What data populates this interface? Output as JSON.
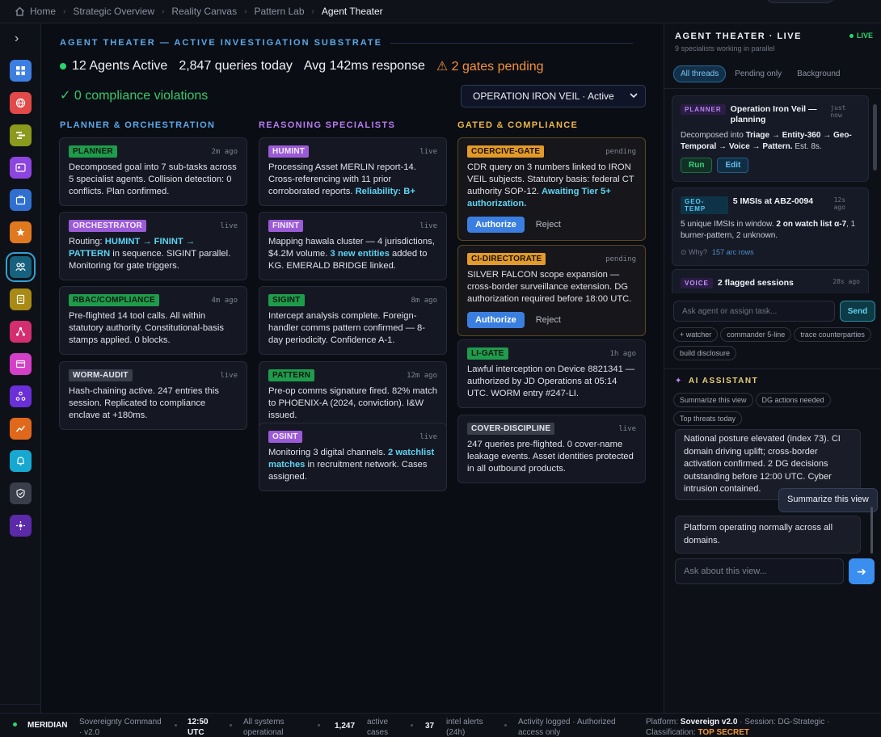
{
  "breadcrumb": {
    "items": [
      "Home",
      "Strategic Overview",
      "Reality Canvas",
      "Pattern Lab",
      "Agent Theater"
    ]
  },
  "main": {
    "section_title": "AGENT THEATER — ACTIVE INVESTIGATION SUBSTRATE",
    "stats": {
      "agents": "12 Agents Active",
      "queries": "2,847 queries today",
      "response": "Avg 142ms response",
      "gates": "⚠ 2 gates pending"
    },
    "compliance": "✓ 0 compliance violations",
    "operation_select": "OPERATION IRON VEIL · Active",
    "columns": {
      "planner": "PLANNER & ORCHESTRATION",
      "reasoning": "REASONING SPECIALISTS",
      "gated": "GATED & COMPLIANCE"
    },
    "cards": {
      "planner": {
        "tag": "PLANNER",
        "time": "2m ago",
        "text": "Decomposed goal into 7 sub-tasks across 5 specialist agents. Collision detection: 0 conflicts. Plan confirmed."
      },
      "orchestrator": {
        "tag": "ORCHESTRATOR",
        "time": "live",
        "pre": "Routing: ",
        "hl": "HUMINT → FININT → PATTERN",
        "post": " in sequence. SIGINT parallel. Monitoring for gate triggers."
      },
      "rbac": {
        "tag": "RBAC/COMPLIANCE",
        "time": "4m ago",
        "text": "Pre-flighted 14 tool calls. All within statutory authority. Constitutional-basis stamps applied. 0 blocks."
      },
      "worm": {
        "tag": "WORM-AUDIT",
        "time": "live",
        "text": "Hash-chaining active. 247 entries this session. Replicated to compliance enclave at +180ms."
      },
      "humint": {
        "tag": "HUMINT",
        "time": "live",
        "pre": "Processing Asset MERLIN report-14. Cross-referencing with 11 prior corroborated reports. ",
        "hl": "Reliability: B+"
      },
      "finint": {
        "tag": "FININT",
        "time": "live",
        "pre": "Mapping hawala cluster — 4 jurisdictions, $4.2M volume. ",
        "hl": "3 new entities",
        "post": " added to KG. EMERALD BRIDGE linked."
      },
      "sigint": {
        "tag": "SIGINT",
        "time": "8m ago",
        "text": "Intercept analysis complete. Foreign-handler comms pattern confirmed — 8-day periodicity. Confidence A-1."
      },
      "pattern": {
        "tag": "PATTERN",
        "time": "12m ago",
        "text": "Pre-op comms signature fired. 82% match to PHOENIX-A (2024, conviction). I&W issued."
      },
      "osint": {
        "tag": "OSINT",
        "time": "live",
        "pre": "Monitoring 3 digital channels. ",
        "hl": "2 watchlist matches",
        "post": " in recruitment network. Cases assigned."
      },
      "coercive": {
        "tag": "COERCIVE-GATE",
        "time": "pending",
        "pre": "CDR query on 3 numbers linked to IRON VEIL subjects. Statutory basis: federal CT authority SOP-12. ",
        "hl": "Awaiting Tier 5+ authorization.",
        "authorize": "Authorize",
        "reject": "Reject"
      },
      "ci": {
        "tag": "CI-DIRECTORATE",
        "time": "pending",
        "text": "SILVER FALCON scope expansion — cross-border surveillance extension. DG authorization required before 18:00 UTC.",
        "authorize": "Authorize",
        "reject": "Reject"
      },
      "li": {
        "tag": "LI-GATE",
        "time": "1h ago",
        "text": "Lawful interception on Device 8821341 — authorized by JD Operations at 05:14 UTC. WORM entry #247-LI."
      },
      "cover": {
        "tag": "COVER-DISCIPLINE",
        "time": "live",
        "text": "247 queries pre-flighted. 0 cover-name leakage events. Asset identities protected in all outbound products."
      }
    }
  },
  "panel": {
    "title": "AGENT THEATER · LIVE",
    "subtitle": "9 specialists working in parallel",
    "live": "LIVE",
    "filters": [
      "All threads",
      "Pending only",
      "Background"
    ],
    "threads": {
      "planner": {
        "tag": "PLANNER",
        "title": "Operation Iron Veil — planning",
        "time": "just now",
        "pre": "Decomposed into ",
        "b": "Triage → Entity-360 → Geo-Temporal → Voice → Pattern.",
        "post": " Est. 8s.",
        "run": "Run",
        "edit": "Edit"
      },
      "geo": {
        "tag": "GEO-TEMP",
        "title": "5 IMSIs at ABZ-0094",
        "time": "12s ago",
        "pre": "5 unique IMSIs in window. ",
        "b": "2 on watch list α-7",
        "post": ", 1 burner-pattern, 2 unknown.",
        "why": "⊙ Why?",
        "rows": "157 arc rows"
      },
      "voice": {
        "tag": "VOICE",
        "title": "2 flagged sessions",
        "time": "28s ago"
      }
    },
    "ask_placeholder": "Ask agent or assign task...",
    "send": "Send",
    "chips": [
      "+ watcher",
      "commander 5-line",
      "trace counterparties",
      "build disclosure"
    ],
    "ai": {
      "title": "AI ASSISTANT",
      "chips": [
        "Summarize this view",
        "DG actions needed",
        "Top threats today"
      ],
      "msg1": "National posture elevated (index 73). CI domain driving uplift; cross-border activation confirmed. 2 DG decisions outstanding before 12:00 UTC. Cyber intrusion contained.",
      "user_msg": "Summarize this view",
      "msg2": "Platform operating normally across all domains.",
      "placeholder": "Ask about this view...",
      "go": "➔"
    }
  },
  "status": {
    "brand": "MERIDIAN",
    "product_1": "Sovereignty Command",
    "product_2": "· v2.0",
    "time_1": "12:50",
    "time_2": "UTC",
    "sys_1": "All systems",
    "sys_2": "operational",
    "cases_v": "1,247",
    "cases_1": "active",
    "cases_2": "cases",
    "alerts_v": "37",
    "alerts_1": "intel alerts",
    "alerts_2": "(24h)",
    "activity_1": "Activity logged · Authorized",
    "activity_2": "access only",
    "platform_pre": "Platform: ",
    "platform_v": "Sovereign v2.0",
    "session": " · Session: DG-Strategic ·",
    "class_pre": "Classification: ",
    "class_v": "TOP SECRET"
  }
}
